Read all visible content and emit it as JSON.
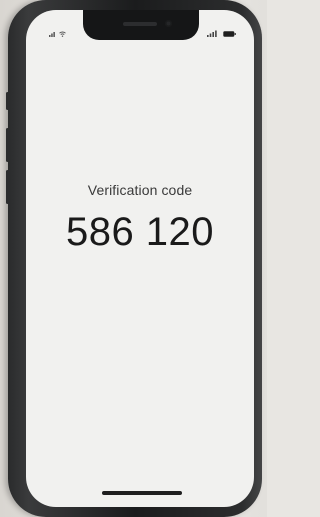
{
  "status_bar": {
    "left_icons": [
      "cellular-signal-icon",
      "wifi-icon"
    ],
    "right_icons": [
      "cellular-bars-icon",
      "battery-icon"
    ]
  },
  "verification": {
    "label": "Verification code",
    "code": "586 120"
  },
  "colors": {
    "screen_background": "#f1f1ef",
    "text_primary": "#1a1a1a",
    "text_secondary": "#3a3a3a",
    "phone_frame": "#1b1c1d"
  }
}
